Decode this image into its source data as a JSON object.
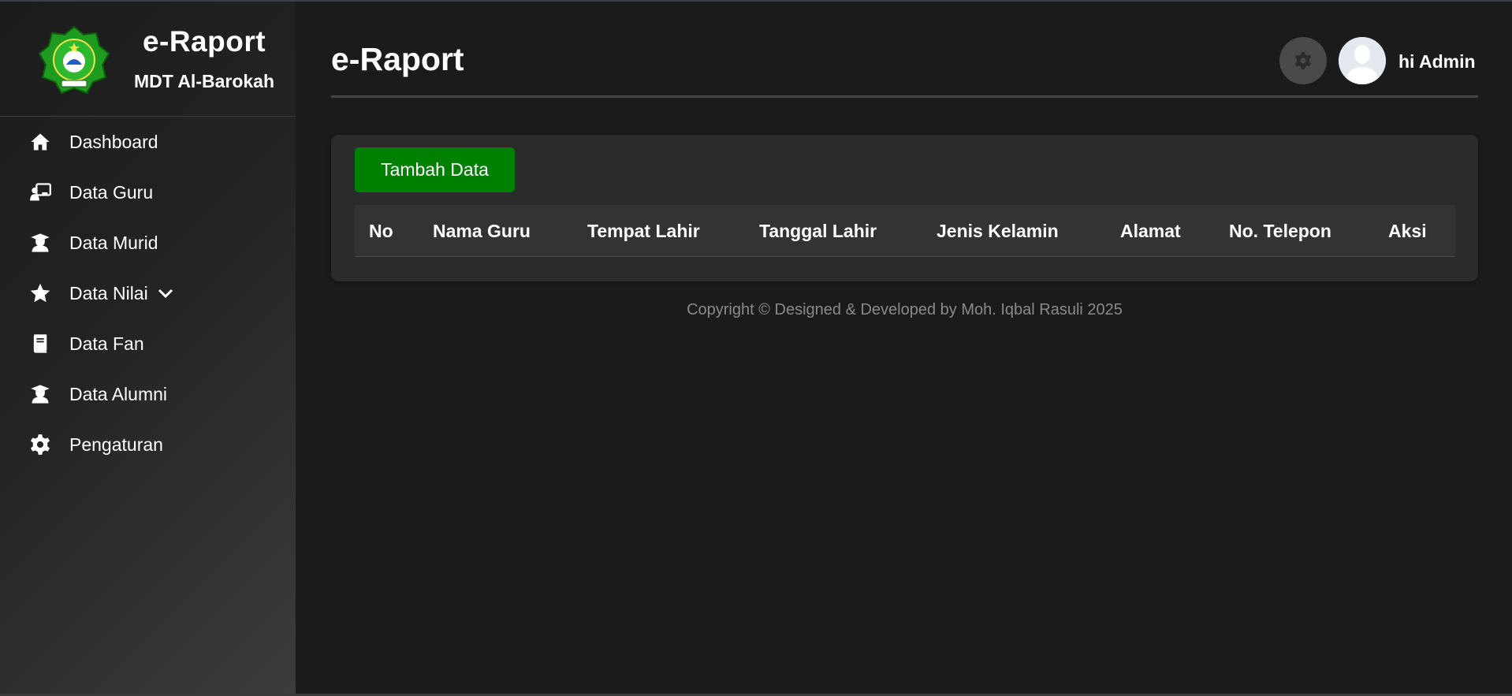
{
  "app": {
    "title": "e-Raport",
    "school": "MDT Al-Barokah"
  },
  "sidebar": {
    "items": [
      {
        "label": "Dashboard",
        "icon": "home-icon"
      },
      {
        "label": "Data Guru",
        "icon": "teacher-board-icon"
      },
      {
        "label": "Data Murid",
        "icon": "graduate-icon"
      },
      {
        "label": "Data Nilai",
        "icon": "star-icon",
        "has_submenu": true
      },
      {
        "label": "Data Fan",
        "icon": "book-icon"
      },
      {
        "label": "Data Alumni",
        "icon": "graduate-icon"
      },
      {
        "label": "Pengaturan",
        "icon": "gear-icon"
      }
    ]
  },
  "header": {
    "title": "e-Raport",
    "greeting": "hi Admin"
  },
  "main": {
    "add_button": "Tambah Data",
    "table": {
      "columns": [
        "No",
        "Nama Guru",
        "Tempat Lahir",
        "Tanggal Lahir",
        "Jenis Kelamin",
        "Alamat",
        "No. Telepon",
        "Aksi"
      ],
      "rows": []
    }
  },
  "footer": {
    "text": "Copyright © Designed & Developed by Moh. Iqbal Rasuli 2025"
  },
  "colors": {
    "accent_button": "#008000",
    "background": "#1b1b1b",
    "card": "#2b2b2b"
  }
}
